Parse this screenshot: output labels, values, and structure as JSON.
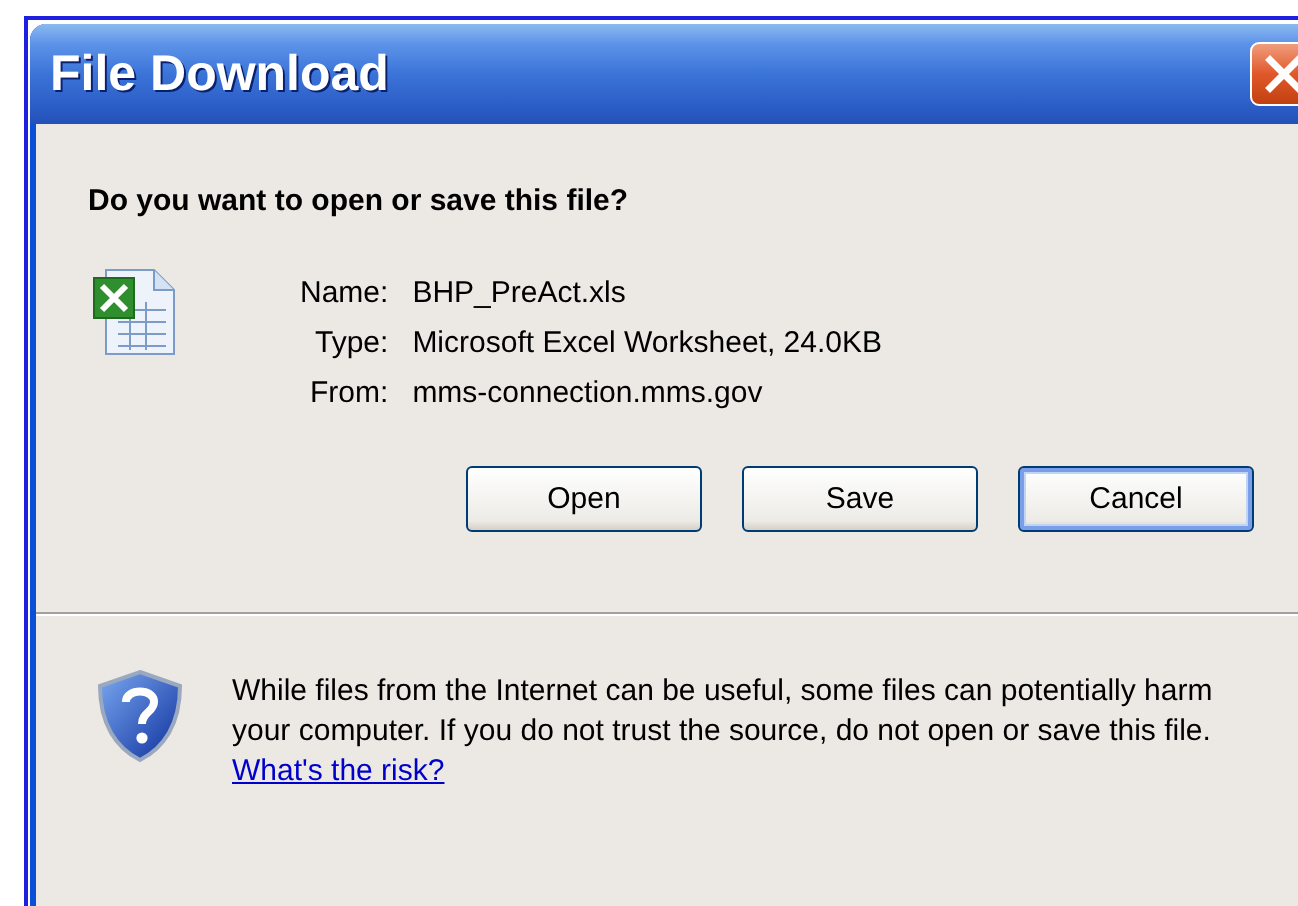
{
  "window": {
    "title": "File Download"
  },
  "question": "Do you want to open or save this file?",
  "file": [
    {
      "label": "Name:",
      "value": "BHP_PreAct.xls"
    },
    {
      "label": "Type:",
      "value": "Microsoft Excel Worksheet, 24.0KB"
    },
    {
      "label": "From:",
      "value": "mms-connection.mms.gov"
    }
  ],
  "buttons": [
    {
      "label": "Open",
      "focused": false
    },
    {
      "label": "Save",
      "focused": false
    },
    {
      "label": "Cancel",
      "focused": true
    }
  ],
  "warning": {
    "text": "While files from the Internet can be useful, some files can potentially harm your computer. If you do not trust the source, do not open or save this file.",
    "link": "What's the risk?"
  }
}
